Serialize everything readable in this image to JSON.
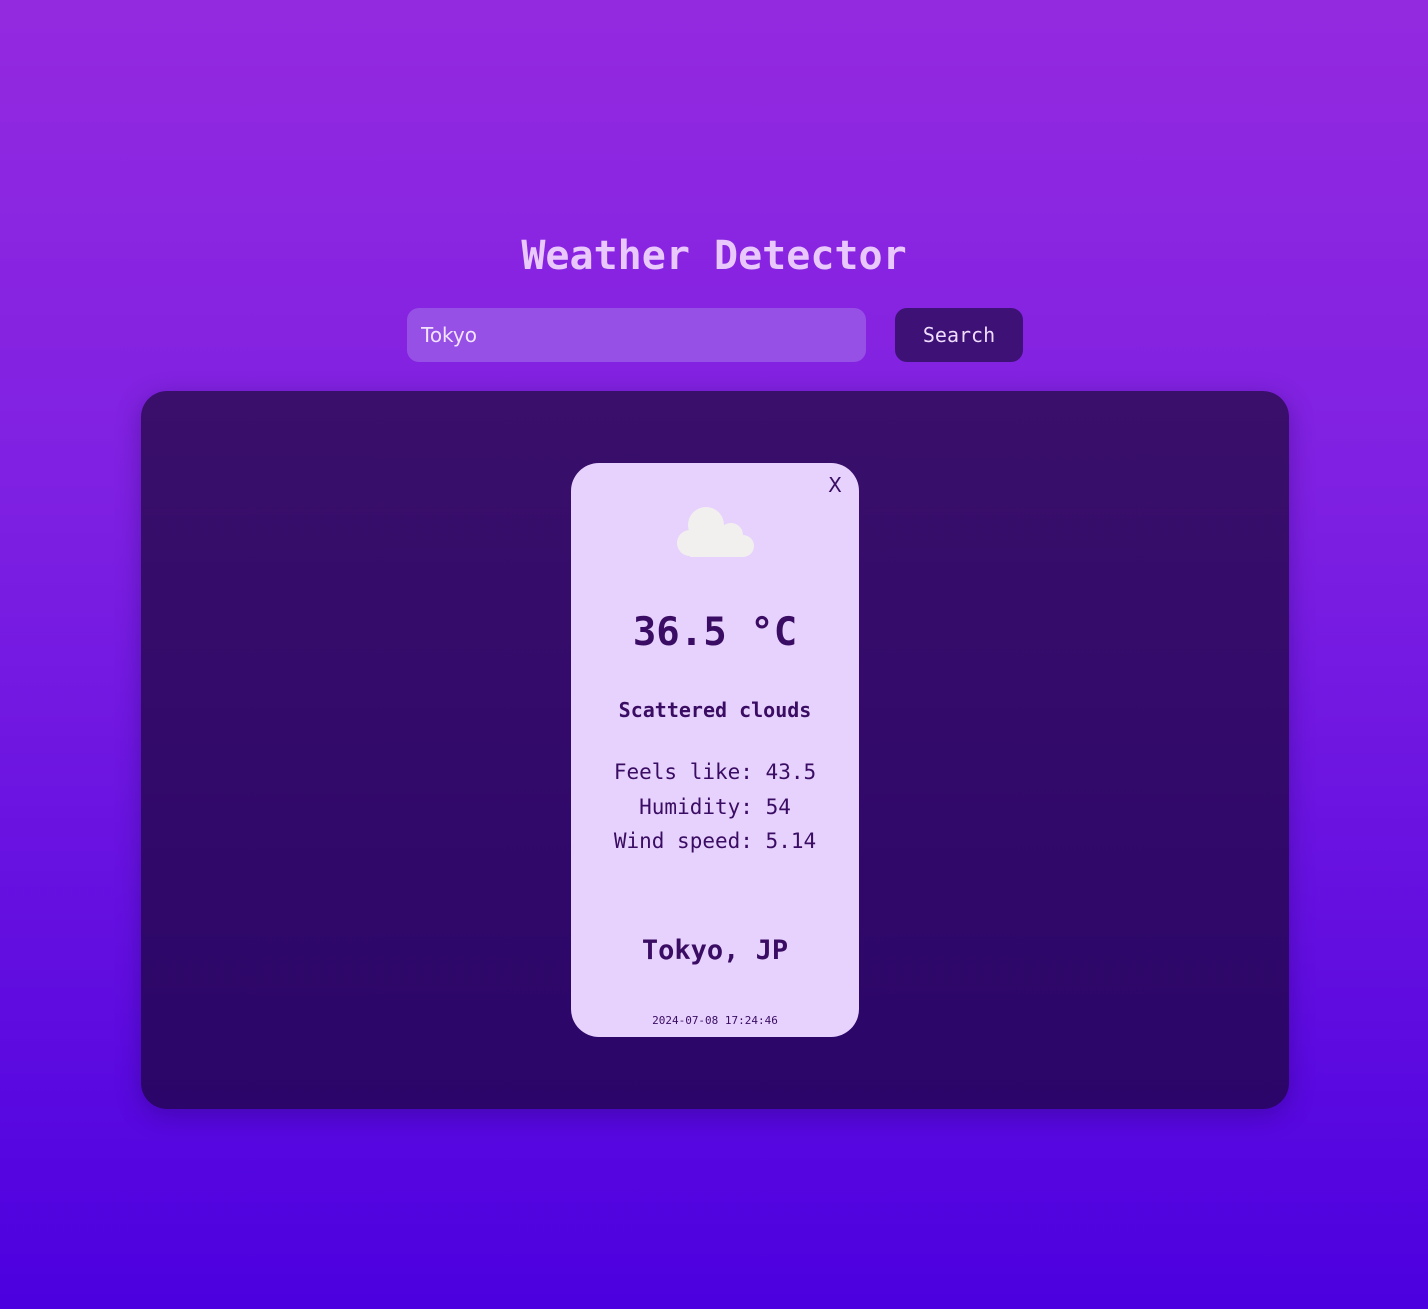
{
  "header": {
    "title": "Weather Detector"
  },
  "search": {
    "value": "Tokyo",
    "button_label": "Search"
  },
  "card": {
    "close_label": "X",
    "icon": "cloud-icon",
    "temperature": "36.5 °C",
    "description": "Scattered clouds",
    "details": [
      "Feels like: 43.5",
      "Humidity: 54",
      "Wind speed: 5.14"
    ],
    "location": "Tokyo, JP",
    "timestamp": "2024-07-08 17:24:46"
  },
  "colors": {
    "background_top": "#942ae0",
    "background_bottom": "#4c00df",
    "panel": "#2e0a6a",
    "card": "#e6d2fc",
    "text_dark": "#3a0c63",
    "title": "#e9c8fb",
    "button": "#3d1175"
  }
}
